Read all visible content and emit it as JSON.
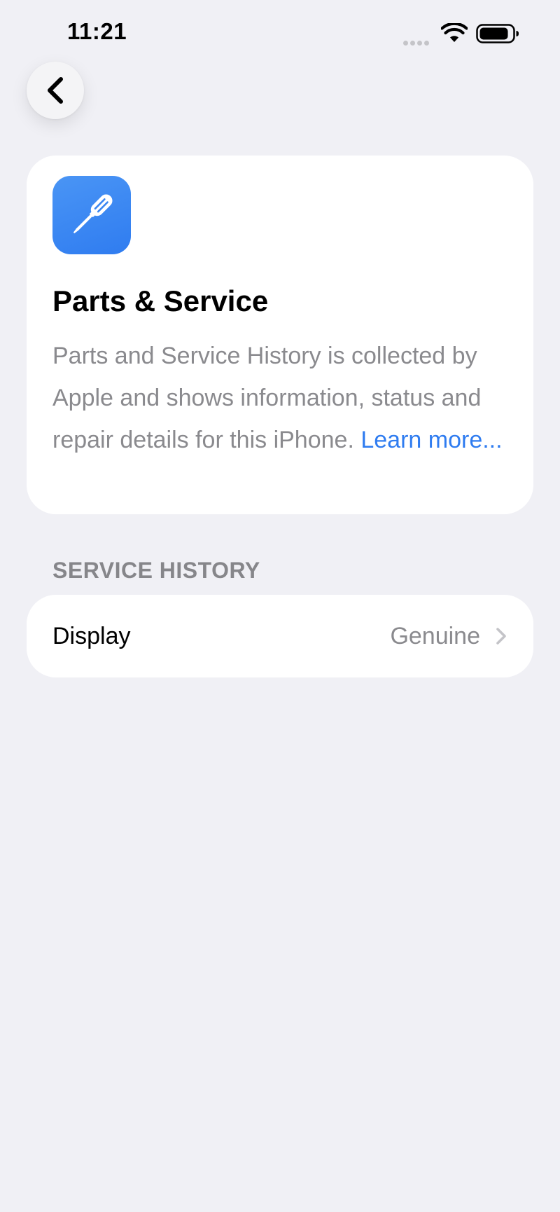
{
  "status_bar": {
    "time": "11:21"
  },
  "navigation": {
    "back_icon": "chevron-left-icon"
  },
  "info_card": {
    "icon": "screwdriver-icon",
    "title": "Parts & Service",
    "description": "Parts and Service History is collected by Apple and shows information, status and repair details for this iPhone.",
    "learn_more_link": "Learn more..."
  },
  "service_history": {
    "section_title": "SERVICE HISTORY",
    "items": [
      {
        "label": "Display",
        "value": "Genuine"
      }
    ]
  },
  "colors": {
    "background": "#f0f0f5",
    "card": "#ffffff",
    "accent": "#2f7cf0",
    "secondary_text": "#8a8a8e"
  }
}
